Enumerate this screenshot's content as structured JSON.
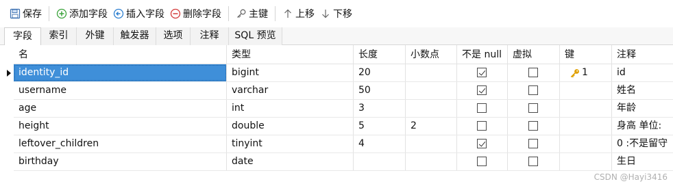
{
  "toolbar": {
    "save": "保存",
    "add_field": "添加字段",
    "insert_field": "插入字段",
    "delete_field": "删除字段",
    "primary_key": "主键",
    "move_up": "上移",
    "move_down": "下移"
  },
  "tabs": [
    {
      "label": "字段",
      "active": true
    },
    {
      "label": "索引",
      "active": false
    },
    {
      "label": "外键",
      "active": false
    },
    {
      "label": "触发器",
      "active": false
    },
    {
      "label": "选项",
      "active": false
    },
    {
      "label": "注释",
      "active": false
    },
    {
      "label": "SQL 预览",
      "active": false
    }
  ],
  "grid": {
    "columns": [
      "名",
      "类型",
      "长度",
      "小数点",
      "不是 null",
      "虚拟",
      "键",
      "注释"
    ],
    "rows": [
      {
        "name": "identity_id",
        "type": "bigint",
        "length": "20",
        "decimals": "",
        "not_null": true,
        "virtual": false,
        "key": "1",
        "comment": "id"
      },
      {
        "name": "username",
        "type": "varchar",
        "length": "50",
        "decimals": "",
        "not_null": true,
        "virtual": false,
        "key": "",
        "comment": "姓名"
      },
      {
        "name": "age",
        "type": "int",
        "length": "3",
        "decimals": "",
        "not_null": false,
        "virtual": false,
        "key": "",
        "comment": "年龄"
      },
      {
        "name": "height",
        "type": "double",
        "length": "5",
        "decimals": "2",
        "not_null": false,
        "virtual": false,
        "key": "",
        "comment": "身高 单位:"
      },
      {
        "name": "leftover_children",
        "type": "tinyint",
        "length": "4",
        "decimals": "",
        "not_null": true,
        "virtual": false,
        "key": "",
        "comment": "0 :不是留守"
      },
      {
        "name": "birthday",
        "type": "date",
        "length": "",
        "decimals": "",
        "not_null": false,
        "virtual": false,
        "key": "",
        "comment": "生日"
      }
    ],
    "selected_row": 0
  },
  "watermark": "CSDN @Hayi3416",
  "colors": {
    "selection": "#3f8fd9",
    "key_icon": "#e0a000",
    "add_icon": "#3aa33a",
    "insert_icon": "#2c7fd1",
    "delete_icon": "#d33a3a"
  },
  "icons": {
    "save": "floppy-disk-icon",
    "add_field": "plus-circle-icon",
    "insert_field": "insert-arrow-circle-icon",
    "delete_field": "minus-circle-icon",
    "primary_key": "key-icon",
    "move_up": "arrow-up-icon",
    "move_down": "arrow-down-icon"
  }
}
